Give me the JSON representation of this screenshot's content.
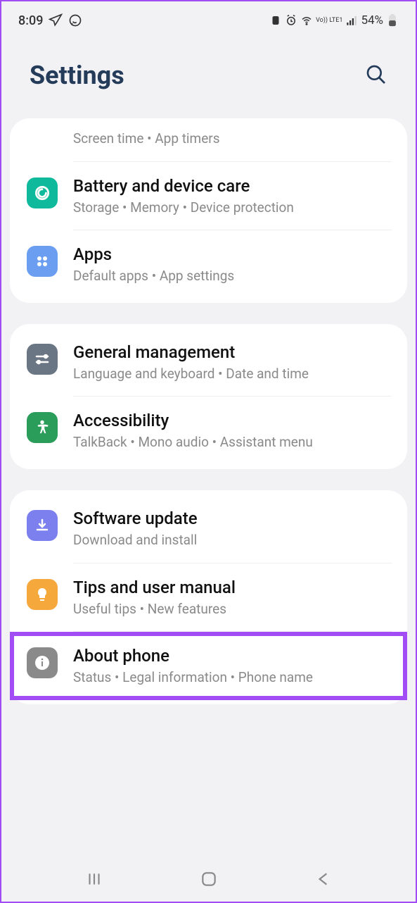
{
  "status": {
    "time": "8:09",
    "battery": "54%",
    "volte": "Vo)) LTE1"
  },
  "header": {
    "title": "Settings"
  },
  "group0": {
    "partial": {
      "sub": "Screen time  •  App timers"
    },
    "battery": {
      "title": "Battery and device care",
      "sub": "Storage  •  Memory  •  Device protection"
    },
    "apps": {
      "title": "Apps",
      "sub": "Default apps  •  App settings"
    }
  },
  "group1": {
    "general": {
      "title": "General management",
      "sub": "Language and keyboard  •  Date and time"
    },
    "accessibility": {
      "title": "Accessibility",
      "sub": "TalkBack  •  Mono audio  •  Assistant menu"
    }
  },
  "group2": {
    "software": {
      "title": "Software update",
      "sub": "Download and install"
    },
    "tips": {
      "title": "Tips and user manual",
      "sub": "Useful tips  •  New features"
    },
    "about": {
      "title": "About phone",
      "sub": "Status  •  Legal information  •  Phone name"
    }
  }
}
